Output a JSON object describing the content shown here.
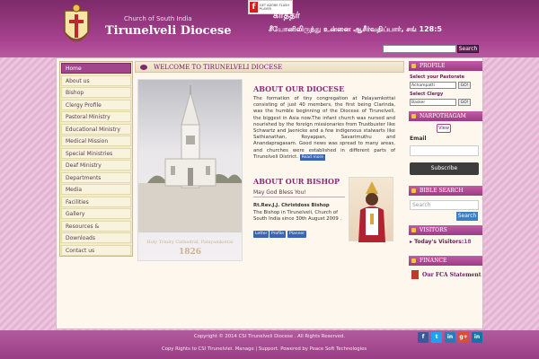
{
  "header": {
    "church": "Church of South India",
    "diocese": "Tirunelveli Diocese",
    "flash_label": "GET ADOBE FLASH PLAYER",
    "tamil_title": "கர்த்தர்",
    "tamil_verse": "சீயோனிலிருந்து உன்னை ஆசீர்வதிப்பார், சங் 128:5",
    "search_button": "Search"
  },
  "nav": [
    "Home",
    "About us",
    "Bishop",
    "Clergy Profile",
    "Pastoral Ministry",
    "Educational Ministry",
    "Medical Mission",
    "Special Ministries",
    "Deaf Ministry",
    "Departments",
    "Media",
    "Facilities",
    "Gallery",
    "Resources &",
    "Downloads",
    "Contact us"
  ],
  "main": {
    "welcome": "WELCOME TO TIRUNELVELI DIOCESE",
    "photo_caption": "Holy Trinity Cathedral, Palayamkottai",
    "photo_year": "1826",
    "about_title": "ABOUT OUR DIOCESE",
    "about_text": "The formation of tiny congregation at Palayamkottai consisting of just 40 members, the first being Clarinda, was the humble beginning of the Diocese of Tirunelveli, the biggest in Asia now.The infant church was nursed and nourished by the foreign missionaries from Trustbuster like Schwartz and Jaenicke and a few indigenous stalwarts like Sathianathan, Royappan, Savarimuthu and Anandapragasam. Good news was spread to many areas, and churches were established in different parts of Tirunelveli District.",
    "read_more": "Read more",
    "bishop_title": "ABOUT OUR BISHOP",
    "bless": "May God Bless You!",
    "bishop_name": "Rt.Rev.J.J. Christdoss Bishop",
    "bishop_desc": "The Bishop in Tirunelveli, Church of South India since 30th August 2009 .",
    "btn_letter": "Letter",
    "btn_profile": "Profile",
    "btn_planner": "Planner"
  },
  "right": {
    "profile_head": "PROFILE",
    "pastorate_label": "Select your Pastorate",
    "pastorate_value": "Achampatti",
    "clergy_label": "Select Clergy",
    "clergy_value": "Basker",
    "go": "GO!",
    "narpothagam_head": "NARPOTHAGAM",
    "view": "View",
    "email_label": "Email",
    "subscribe": "Subscribe",
    "bible_head": "BIBLE SEARCH",
    "bible_search": "Search",
    "visitors_head": "VISITORS",
    "visitors_label": "Today's Visitors:",
    "visitors_count": "18",
    "finance_head": "FINANCE",
    "fca": "Our FCA Statement"
  },
  "footer": {
    "copyright": "Copyright © 2014 CSI Tirunelveli Diocese . All Rights Reserved.",
    "rights": "Copy Rights to CSI Tirunelvlei. Manage | Support. Powered by Peace Soft Technologies",
    "social": [
      "f",
      "t",
      "in",
      "g+",
      "in"
    ]
  },
  "colors": {
    "brand": "#a3458c",
    "header": "#8c3379",
    "link": "#3c64b5"
  }
}
